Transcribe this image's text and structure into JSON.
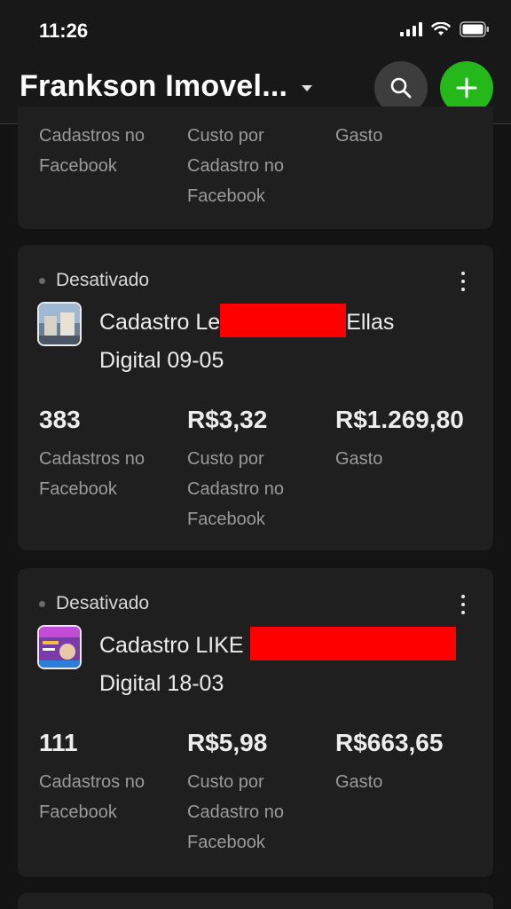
{
  "status_bar": {
    "time": "11:26"
  },
  "header": {
    "title": "Frankson Imovel..."
  },
  "partial_card": {
    "labels": [
      "Cadastros no Facebook",
      "Custo por Cadastro no Facebook",
      "Gasto"
    ]
  },
  "cards": [
    {
      "status": "Desativado",
      "name_prefix": "Cadastro Le",
      "name_suffix": "Ellas",
      "name_line2": "Digital 09-05",
      "metrics": [
        {
          "value": "383",
          "label": "Cadastros no Facebook"
        },
        {
          "value": "R$3,32",
          "label": "Custo por Cadastro no Facebook"
        },
        {
          "value": "R$1.269,80",
          "label": "Gasto"
        }
      ]
    },
    {
      "status": "Desativado",
      "name_prefix": "Cadastro LIKE",
      "name_suffix": "",
      "name_line2": "Digital 18-03",
      "metrics": [
        {
          "value": "111",
          "label": "Cadastros no Facebook"
        },
        {
          "value": "R$5,98",
          "label": "Custo por Cadastro no Facebook"
        },
        {
          "value": "R$663,65",
          "label": "Gasto"
        }
      ]
    }
  ],
  "colors": {
    "accent_green": "#24b81b",
    "redaction": "#ff0000"
  },
  "icons": [
    "search-icon",
    "plus-icon",
    "more-vertical-icon",
    "chevron-down-icon"
  ]
}
